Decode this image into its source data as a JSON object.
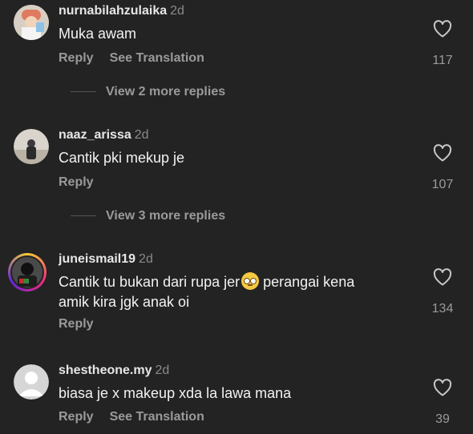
{
  "comments": [
    {
      "username": "nurnabilahzulaika",
      "time": "2d",
      "text": "Muka awam",
      "reply": "Reply",
      "translate": "See Translation",
      "likes": "117",
      "view_more": "View 2 more replies"
    },
    {
      "username": "naaz_arissa",
      "time": "2d",
      "text": "Cantik pki mekup je",
      "reply": "Reply",
      "likes": "107",
      "view_more": "View 3 more replies"
    },
    {
      "username": "juneismail19",
      "time": "2d",
      "text_line1": "Cantik tu bukan dari rupa jer",
      "text_line1_after": " perangai kena",
      "text_line2": "amik kira jgk anak oi",
      "reply": "Reply",
      "likes": "134"
    },
    {
      "username": "shestheone.my",
      "time": "2d",
      "text": "biasa je x makeup xda la lawa mana",
      "reply": "Reply",
      "translate": "See Translation",
      "likes": "39"
    }
  ],
  "colors": {
    "background": "#232323",
    "username": "#e6e6e6",
    "muted": "#9a9a9a"
  },
  "icons": [
    "heart-outline-icon",
    "rolling-eyes-emoji"
  ]
}
